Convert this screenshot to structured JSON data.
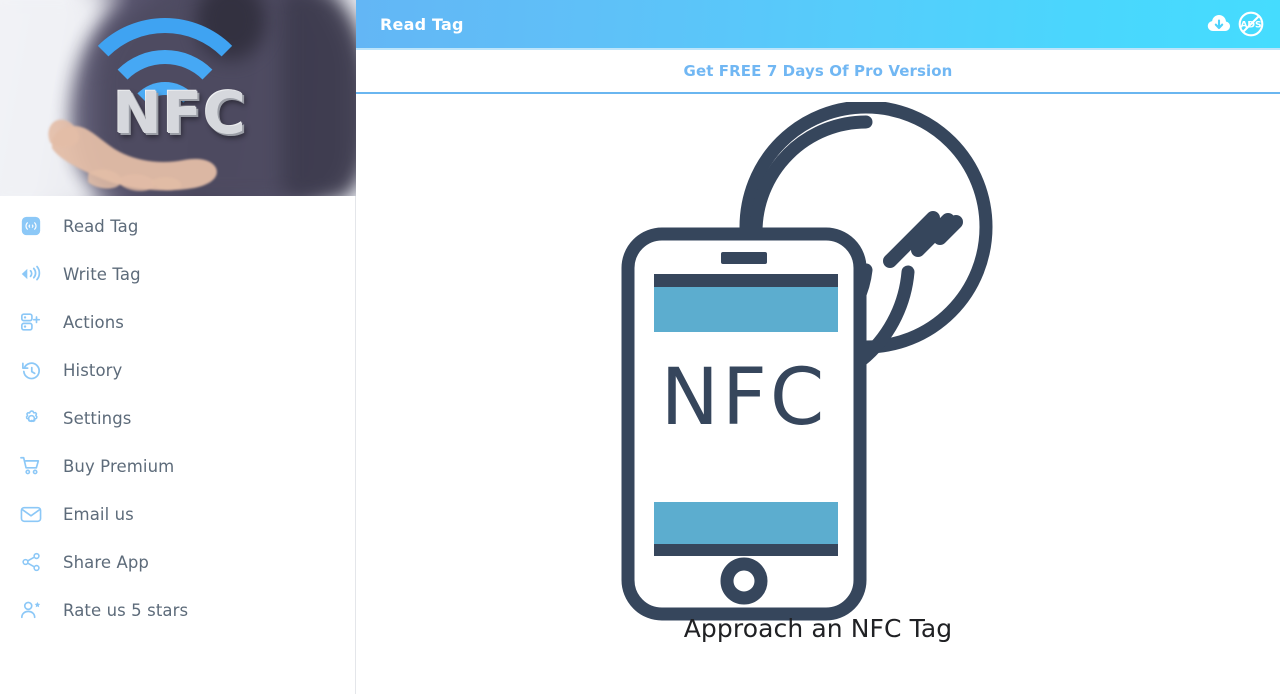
{
  "app": {
    "brand_text": "NFC",
    "accent_blue": "#7cc0f5",
    "header_gradient_from": "#63b6f5",
    "header_gradient_to": "#45dcfe",
    "illustration_navy": "#36465c",
    "illustration_teal": "#5cadcf"
  },
  "topbar": {
    "title": "Read Tag",
    "icons": [
      {
        "name": "cloud-download-icon",
        "label": "Cloud download"
      },
      {
        "name": "no-ads-icon",
        "label": "ADS"
      }
    ]
  },
  "promo": {
    "text": "Get FREE 7 Days Of Pro Version"
  },
  "sidebar": {
    "header_image_alt": "Hand holding NFC logo",
    "items": [
      {
        "label": "Read Tag",
        "icon": "nfc-tag-read-icon",
        "active": true
      },
      {
        "label": "Write Tag",
        "icon": "nfc-broadcast-write-icon",
        "active": false
      },
      {
        "label": "Actions",
        "icon": "actions-list-plus-icon",
        "active": false
      },
      {
        "label": "History",
        "icon": "history-clock-icon",
        "active": false
      },
      {
        "label": "Settings",
        "icon": "gear-icon",
        "active": false
      },
      {
        "label": "Buy Premium",
        "icon": "shopping-cart-icon",
        "active": false
      },
      {
        "label": "Email us",
        "icon": "envelope-icon",
        "active": false
      },
      {
        "label": "Share App",
        "icon": "share-nodes-icon",
        "active": false
      },
      {
        "label": "Rate us 5 stars",
        "icon": "user-star-icon",
        "active": false
      }
    ]
  },
  "main": {
    "illustration": "phone-tapping-nfc-tag-illustration",
    "phone_screen_text": "NFC",
    "caption": "Approach an NFC Tag"
  }
}
